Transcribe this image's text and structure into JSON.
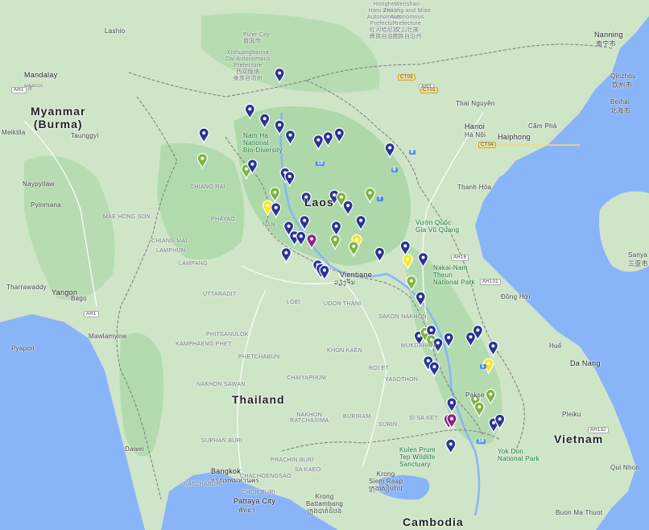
{
  "map": {
    "colors": {
      "water": "#8ab4f8",
      "land": "#cfe5c8",
      "forest": "#9fd39b",
      "border": "#7a7a7a",
      "road": "#ffffff",
      "marker_blue": "#283593",
      "marker_green": "#7cb342",
      "marker_yellow": "#fbe61b",
      "marker_purple": "#8e2487"
    },
    "countries": {
      "myanmar": "Myanmar\n(Burma)",
      "thailand": "Thailand",
      "laos": "Laos",
      "vietnam": "Vietnam",
      "cambodia": "Cambodia"
    },
    "cities": {
      "mandalay": "Mandalay",
      "mandalay_local": "မန္တလေး",
      "hanoi": "Hanoi",
      "hanoi_local": "Hà Nội",
      "haiphong": "Haiphong",
      "vientiane": "Vientiane",
      "vientiane_local": "ວຽງຈັນ",
      "bangkok": "Bangkok",
      "bangkok_local": "กรุงเทพมหานคร",
      "nanning": "Nanning",
      "nanning_local": "南宁市",
      "yangon": "Yangon",
      "danang": "Da Nang",
      "pattaya": "Pattaya City",
      "pattaya_local": "พัทยา",
      "pakse": "Pakse",
      "hue": "Huế",
      "naypyitaw": "Naypyitaw",
      "taunggyi": "Taunggyi",
      "mawlamyine": "Mawlamyine",
      "bago": "Bago",
      "thai_nguyen": "Thái Nguyên",
      "qinzhou": "Qinzhou",
      "qinzhou_local": "钦州市",
      "beihai": "Beihai",
      "beihai_local": "北海市",
      "lashio": "Lashio",
      "meiktila": "Meiktila",
      "pyinmana": "Pyinmana",
      "tharrawaddy": "Tharrawaddy",
      "pyapon": "Pyapon",
      "dawei": "Dawei",
      "cam_pha": "Cẩm Phả",
      "thanh_hoa": "Thanh Hóa",
      "dong_hoi": "Đồng Hới",
      "quy_nhon": "Qui Nhon",
      "buon_ma_thuot": "Buon Ma Thuot",
      "pleiku": "Pleiku",
      "sanya": "Sanya",
      "sanya_local": "三亚市",
      "mukdahan": "MUKDAHAN",
      "udon_thani": "UDON THANI",
      "khon_kaen": "KHON KAEN",
      "nakhon_ratchasima": "NAKHON\nRATCHASIMA"
    },
    "provinces": [
      "CHIANG RAI",
      "PHAYAO",
      "NAN",
      "CHIANG MAI",
      "LAMPANG",
      "MAE HONG SON",
      "LAMPHUN",
      "UTTARADIT",
      "PHITSANULOK",
      "KAMPHAENG PHET",
      "PHETCHABUN",
      "LOEI",
      "SAKON NAKHON",
      "ROI ET",
      "YASOTHON",
      "CHAIYAPHUM",
      "NAKHON SAWAN",
      "BURIRAM",
      "SURIN",
      "SI SA KET",
      "SUPHAN BURI",
      "PRACHIN BURI",
      "RATCHABURI",
      "CHACHOENGSAO",
      "SA KAEO",
      "CHON BURI"
    ],
    "parks": {
      "nam_ha": "Nam Ha\nNational\nBio-Diversity",
      "nakai": "Nakai-Nam\nTheun\nNational Park",
      "vu_quang": "Vườn Quốc\nGia Vũ Quang",
      "kulen": "Kulen Prum\nTep Wildlife\nSanctuary",
      "yok_don": "Yok Don\nNational Park"
    },
    "prefectures": {
      "xishuangbanna": "Xishuangbanna\nDai Autonomous\nPrefecture\n西双版纳\n傣族自治州",
      "honghe": "Honghe\nHani and Yi\nAutonomous\nPrefecture\n红河哈尼族\n彝族自治州",
      "wenshan": "Wenshan\nZhuang and Miao\nAutonomous\nPrefecture\n文山壮族\n苗族自治州",
      "puer": "Pu'er City\n普洱市"
    },
    "krong": "Krong\nSiem Reap\nក្រុងសៀមរាប",
    "krong_batt": "Krong\nBattambang\nក្រុងបាត់ដំបង",
    "highway_labels": [
      "AH1",
      "AH2",
      "AH3",
      "AH12",
      "AH13",
      "AH14",
      "AH15",
      "AH16",
      "AH131",
      "AH132",
      "13",
      "7",
      "6",
      "9",
      "8",
      "12",
      "1",
      "14",
      "CT01",
      "CT05",
      "CT04"
    ]
  },
  "markers": [
    {
      "color": "blue",
      "lng": 101.47,
      "lat": 21.64
    },
    {
      "color": "blue",
      "lng": 100.89,
      "lat": 20.96
    },
    {
      "color": "blue",
      "lng": 101.18,
      "lat": 20.78
    },
    {
      "color": "blue",
      "lng": 101.47,
      "lat": 20.66
    },
    {
      "color": "blue",
      "lng": 101.68,
      "lat": 20.47
    },
    {
      "color": "blue",
      "lng": 102.23,
      "lat": 20.38
    },
    {
      "color": "blue",
      "lng": 102.42,
      "lat": 20.44
    },
    {
      "color": "blue",
      "lng": 102.64,
      "lat": 20.51
    },
    {
      "color": "blue",
      "lng": 103.63,
      "lat": 20.23
    },
    {
      "color": "blue",
      "lng": 99.99,
      "lat": 20.51
    },
    {
      "color": "green",
      "lng": 99.96,
      "lat": 20.03
    },
    {
      "color": "green",
      "lng": 100.82,
      "lat": 19.83
    },
    {
      "color": "blue",
      "lng": 100.94,
      "lat": 19.92
    },
    {
      "color": "blue",
      "lng": 101.58,
      "lat": 19.76
    },
    {
      "color": "blue",
      "lng": 101.67,
      "lat": 19.69
    },
    {
      "color": "green",
      "lng": 101.38,
      "lat": 19.39
    },
    {
      "color": "blue",
      "lng": 101.99,
      "lat": 19.3
    },
    {
      "color": "blue",
      "lng": 102.54,
      "lat": 19.34
    },
    {
      "color": "green",
      "lng": 102.68,
      "lat": 19.3
    },
    {
      "color": "blue",
      "lng": 102.81,
      "lat": 19.14
    },
    {
      "color": "green",
      "lng": 103.24,
      "lat": 19.38
    },
    {
      "color": "yellow",
      "lng": 101.24,
      "lat": 19.14
    },
    {
      "color": "blue",
      "lng": 101.4,
      "lat": 19.1
    },
    {
      "color": "blue",
      "lng": 101.96,
      "lat": 18.86
    },
    {
      "color": "blue",
      "lng": 103.06,
      "lat": 18.86
    },
    {
      "color": "blue",
      "lng": 101.65,
      "lat": 18.75
    },
    {
      "color": "blue",
      "lng": 102.58,
      "lat": 18.75
    },
    {
      "color": "blue",
      "lng": 101.76,
      "lat": 18.57
    },
    {
      "color": "blue",
      "lng": 101.89,
      "lat": 18.56
    },
    {
      "color": "purple",
      "lng": 102.1,
      "lat": 18.51
    },
    {
      "color": "green",
      "lng": 102.56,
      "lat": 18.5
    },
    {
      "color": "yellow",
      "lng": 102.98,
      "lat": 18.5
    },
    {
      "color": "green",
      "lng": 102.92,
      "lat": 18.37
    },
    {
      "color": "blue",
      "lng": 101.6,
      "lat": 18.25
    },
    {
      "color": "blue",
      "lng": 103.43,
      "lat": 18.26
    },
    {
      "color": "blue",
      "lng": 103.93,
      "lat": 18.38
    },
    {
      "color": "yellow",
      "lng": 103.98,
      "lat": 18.13
    },
    {
      "color": "blue",
      "lng": 104.28,
      "lat": 18.16
    },
    {
      "color": "blue",
      "lng": 102.22,
      "lat": 18.02
    },
    {
      "color": "blue",
      "lng": 102.28,
      "lat": 17.95
    },
    {
      "color": "blue",
      "lng": 102.35,
      "lat": 17.92
    },
    {
      "color": "green",
      "lng": 104.05,
      "lat": 17.72
    },
    {
      "color": "blue",
      "lng": 104.23,
      "lat": 17.42
    },
    {
      "color": "blue",
      "lng": 104.2,
      "lat": 16.68
    },
    {
      "color": "green",
      "lng": 104.32,
      "lat": 16.75
    },
    {
      "color": "blue",
      "lng": 104.44,
      "lat": 16.79
    },
    {
      "color": "green",
      "lng": 104.44,
      "lat": 16.61
    },
    {
      "color": "blue",
      "lng": 104.57,
      "lat": 16.55
    },
    {
      "color": "blue",
      "lng": 104.78,
      "lat": 16.65
    },
    {
      "color": "blue",
      "lng": 105.21,
      "lat": 16.66
    },
    {
      "color": "blue",
      "lng": 105.35,
      "lat": 16.79
    },
    {
      "color": "blue",
      "lng": 105.65,
      "lat": 16.49
    },
    {
      "color": "yellow",
      "lng": 105.56,
      "lat": 16.16
    },
    {
      "color": "blue",
      "lng": 104.38,
      "lat": 16.21
    },
    {
      "color": "blue",
      "lng": 104.5,
      "lat": 16.1
    },
    {
      "color": "green",
      "lng": 105.6,
      "lat": 15.58
    },
    {
      "color": "green",
      "lng": 105.3,
      "lat": 15.49
    },
    {
      "color": "blue",
      "lng": 104.84,
      "lat": 15.42
    },
    {
      "color": "green",
      "lng": 105.38,
      "lat": 15.34
    },
    {
      "color": "blue",
      "lng": 105.66,
      "lat": 15.04
    },
    {
      "color": "blue",
      "lng": 105.78,
      "lat": 15.11
    },
    {
      "color": "purple",
      "lng": 104.78,
      "lat": 15.11
    },
    {
      "color": "purple",
      "lng": 104.84,
      "lat": 15.12
    },
    {
      "color": "blue",
      "lng": 104.82,
      "lat": 14.64
    }
  ]
}
